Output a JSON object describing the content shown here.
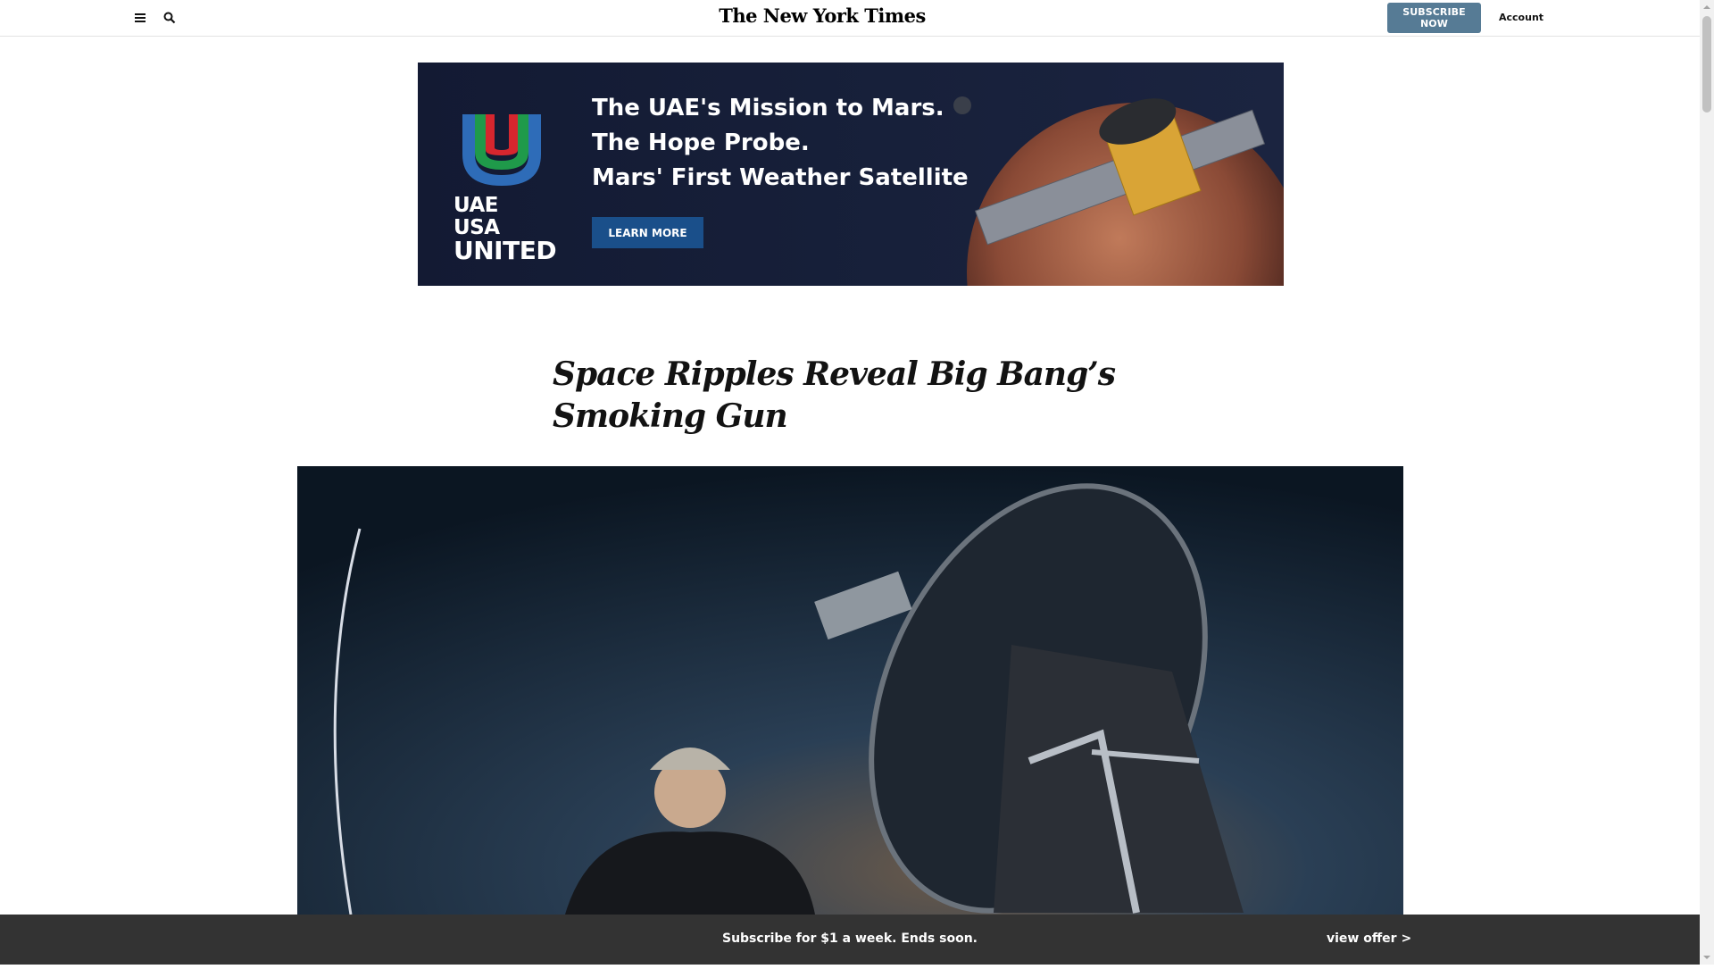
{
  "header": {
    "logo_text": "The New York Times",
    "subscribe_label": "SUBSCRIBE NOW",
    "account_label": "Account",
    "menu_icon": "hamburger-menu-icon",
    "search_icon": "search-icon"
  },
  "ad": {
    "logo_line1": "UAE USA",
    "logo_line2": "UNITED",
    "headline": [
      "The UAE's Mission to Mars.",
      "The Hope Probe.",
      "Mars' First Weather Satellite"
    ],
    "cta_label": "LEARN MORE"
  },
  "article": {
    "headline": "Space Ripples Reveal Big Bang’s Smoking Gun"
  },
  "footer_bar": {
    "message": "Subscribe for $1 a week. Ends soon.",
    "offer_link": "view offer >"
  },
  "colors": {
    "subscribe_button": "#567b95",
    "ad_background": "#131a33",
    "ad_button": "#1a4f8a",
    "footer_bar": "#333333"
  }
}
